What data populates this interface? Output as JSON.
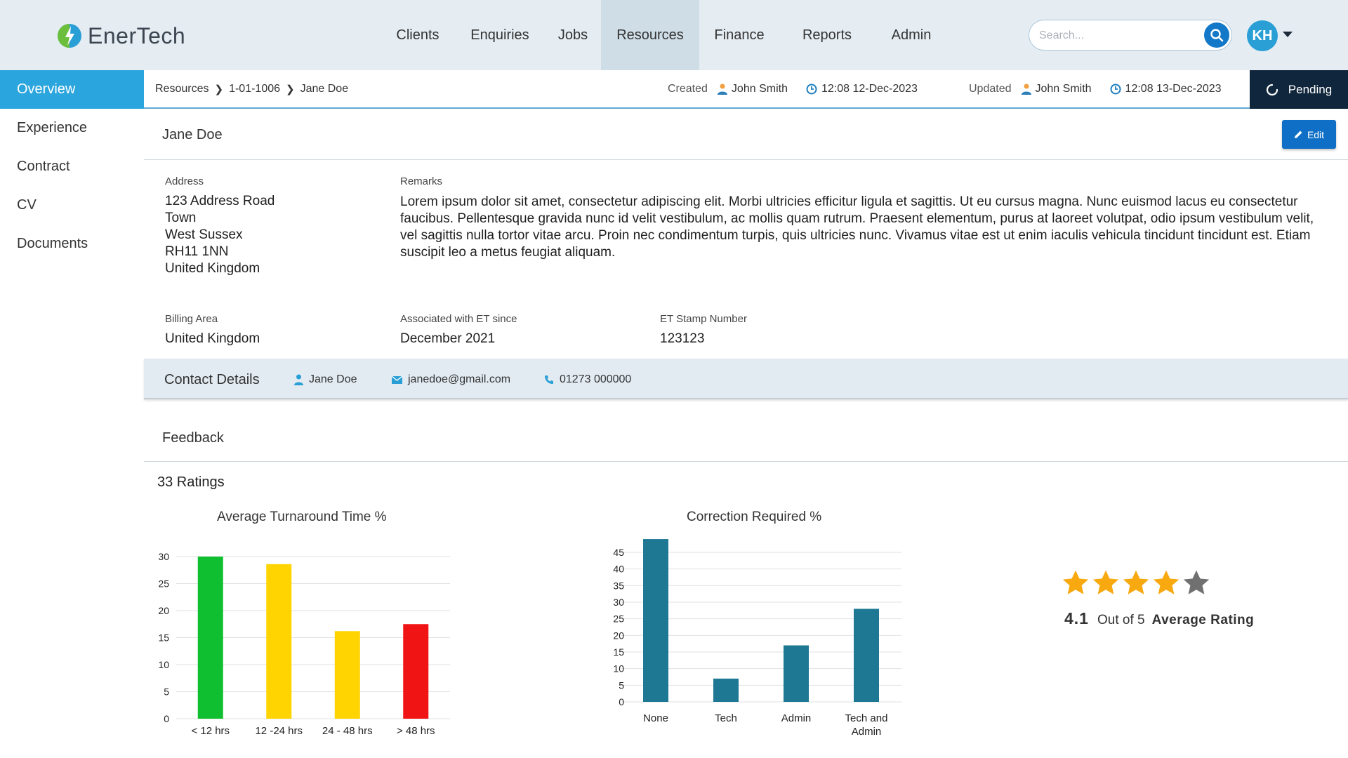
{
  "app": {
    "name": "EnerTech"
  },
  "nav": {
    "items": [
      "Clients",
      "Enquiries",
      "Jobs",
      "Resources",
      "Finance",
      "Reports",
      "Admin"
    ],
    "active": "Resources"
  },
  "search": {
    "placeholder": "Search..."
  },
  "user": {
    "initials": "KH"
  },
  "sidebar": {
    "items": [
      "Overview",
      "Experience",
      "Contract",
      "CV",
      "Documents"
    ],
    "active": "Overview"
  },
  "breadcrumb": [
    "Resources",
    "1-01-1006",
    "Jane Doe"
  ],
  "record": {
    "created_label": "Created",
    "created_by": "John Smith",
    "created_at": "12:08 12-Dec-2023",
    "updated_label": "Updated",
    "updated_by": "John Smith",
    "updated_at": "12:08 13-Dec-2023",
    "status": "Pending"
  },
  "person": {
    "name": "Jane Doe",
    "edit_label": "Edit"
  },
  "details": {
    "address_label": "Address",
    "address_lines": [
      "123 Address Road",
      "Town",
      "West Sussex",
      "RH11 1NN",
      "United Kingdom"
    ],
    "remarks_label": "Remarks",
    "remarks": "Lorem ipsum dolor sit amet, consectetur adipiscing elit. Morbi ultricies efficitur ligula et sagittis. Ut eu cursus magna. Nunc euismod lacus eu consectetur faucibus. Pellentesque gravida nunc id velit vestibulum, ac mollis quam rutrum. Praesent elementum, purus at laoreet volutpat, odio ipsum vestibulum velit, vel sagittis nulla tortor vitae arcu. Proin nec condimentum turpis, quis ultricies nunc. Vivamus vitae est ut enim iaculis vehicula tincidunt tincidunt est. Etiam suscipit leo a metus feugiat aliquam.",
    "billing_label": "Billing Area",
    "billing": "United Kingdom",
    "since_label": "Associated with ET since",
    "since": "December 2021",
    "stamp_label": "ET Stamp Number",
    "stamp": "123123"
  },
  "contact": {
    "title": "Contact Details",
    "name": "Jane Doe",
    "email": "janedoe@gmail.com",
    "phone": "01273 000000"
  },
  "feedback": {
    "title": "Feedback",
    "ratings_count": "33 Ratings"
  },
  "rating": {
    "value": "4.1",
    "out_of": "Out of 5",
    "label": "Average Rating",
    "stars_filled": 4,
    "stars_total": 5
  },
  "colors": {
    "accent": "#2ba5dd",
    "status_bg": "#10263c",
    "edit_btn": "#0f6fc6",
    "star": "#f7a90f",
    "star_empty": "#707070"
  },
  "chart_data": [
    {
      "type": "bar",
      "title": "Average Turnaround Time %",
      "categories": [
        "< 12 hrs",
        "12 -24 hrs",
        "24 - 48 hrs",
        "> 48 hrs"
      ],
      "values": [
        30,
        28.6,
        16.2,
        17.5
      ],
      "colors": [
        "#0fbf2f",
        "#ffd400",
        "#ffd400",
        "#f01414"
      ],
      "ylim": [
        0,
        30
      ],
      "yticks": [
        0,
        5,
        10,
        15,
        20,
        25,
        30
      ],
      "grid": true
    },
    {
      "type": "bar",
      "title": "Correction Required %",
      "categories": [
        "None",
        "Tech",
        "Admin",
        "Tech and Admin"
      ],
      "values": [
        49,
        7,
        17,
        28
      ],
      "colors": [
        "#1e7894",
        "#1e7894",
        "#1e7894",
        "#1e7894"
      ],
      "ylim": [
        0,
        45
      ],
      "yticks": [
        0,
        5,
        10,
        15,
        20,
        25,
        30,
        35,
        40,
        45
      ],
      "grid": true
    }
  ]
}
